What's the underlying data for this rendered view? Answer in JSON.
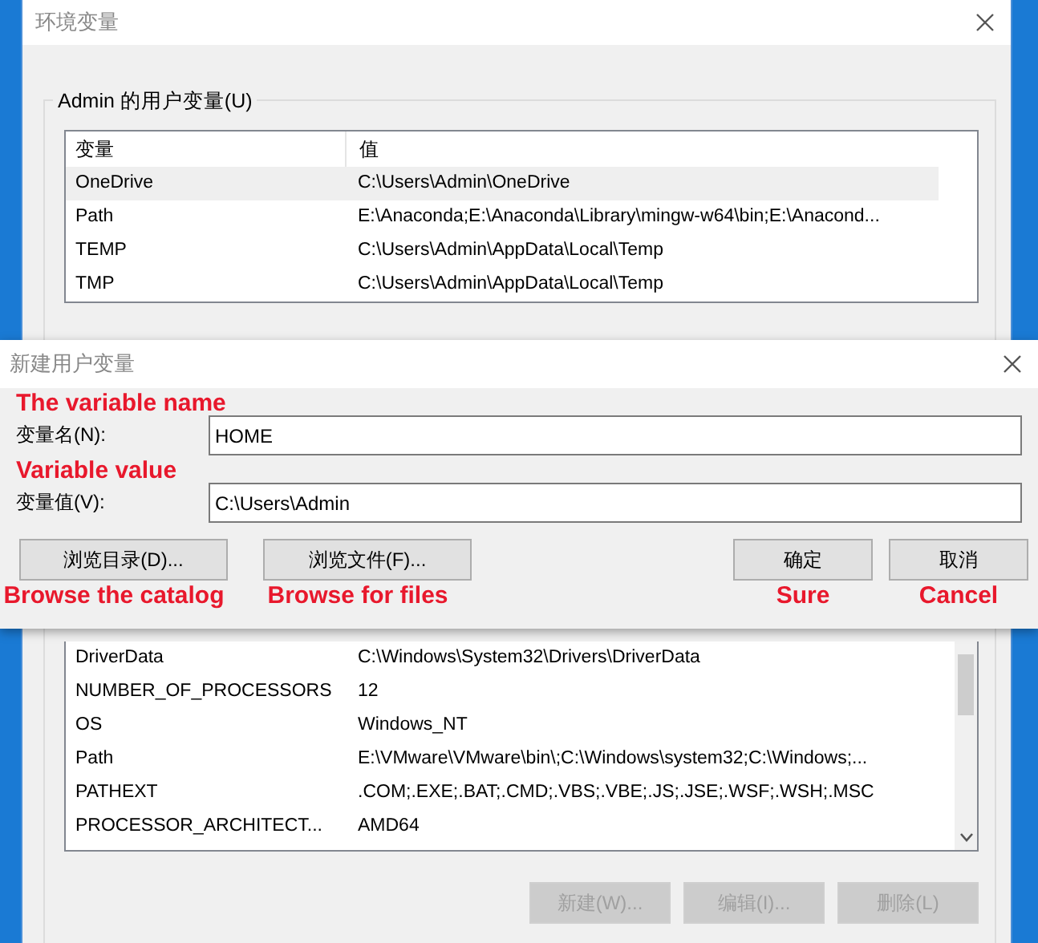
{
  "background_window": {
    "title": "环境变量",
    "user_variables": {
      "label": "Admin 的用户变量(U)",
      "columns": [
        "变量",
        "值"
      ],
      "rows": [
        {
          "name": "OneDrive",
          "value": "C:\\Users\\Admin\\OneDrive",
          "selected": true
        },
        {
          "name": "Path",
          "value": "E:\\Anaconda;E:\\Anaconda\\Library\\mingw-w64\\bin;E:\\Anacond...",
          "selected": false
        },
        {
          "name": "TEMP",
          "value": "C:\\Users\\Admin\\AppData\\Local\\Temp",
          "selected": false
        },
        {
          "name": "TMP",
          "value": "C:\\Users\\Admin\\AppData\\Local\\Temp",
          "selected": false
        }
      ]
    },
    "system_variables": {
      "rows": [
        {
          "name": "DriverData",
          "value": "C:\\Windows\\System32\\Drivers\\DriverData",
          "selected": false
        },
        {
          "name": "NUMBER_OF_PROCESSORS",
          "value": "12",
          "selected": false
        },
        {
          "name": "OS",
          "value": "Windows_NT",
          "selected": false
        },
        {
          "name": "Path",
          "value": "E:\\VMware\\VMware\\bin\\;C:\\Windows\\system32;C:\\Windows;...",
          "selected": false
        },
        {
          "name": "PATHEXT",
          "value": ".COM;.EXE;.BAT;.CMD;.VBS;.VBE;.JS;.JSE;.WSF;.WSH;.MSC",
          "selected": false
        },
        {
          "name": "PROCESSOR_ARCHITECT...",
          "value": "AMD64",
          "selected": false
        }
      ]
    },
    "buttons": [
      {
        "label": "新建(W)...",
        "disabled": true
      },
      {
        "label": "编辑(I)...",
        "disabled": true
      },
      {
        "label": "删除(L)",
        "disabled": true
      }
    ]
  },
  "dialog": {
    "title": "新建用户变量",
    "fields": [
      {
        "annotation": "The variable name",
        "label": "变量名(N):",
        "value": "HOME"
      },
      {
        "annotation": "Variable value",
        "label": "变量值(V):",
        "value": "C:\\Users\\Admin"
      }
    ],
    "buttons": [
      {
        "kind": "left",
        "label": "浏览目录(D)...",
        "annotation": "Browse the catalog"
      },
      {
        "kind": "left",
        "label": "浏览文件(F)...",
        "annotation": "Browse for files"
      },
      {
        "kind": "right",
        "label": "确定",
        "annotation": "Sure"
      },
      {
        "kind": "right",
        "label": "取消",
        "annotation": "Cancel"
      }
    ]
  }
}
